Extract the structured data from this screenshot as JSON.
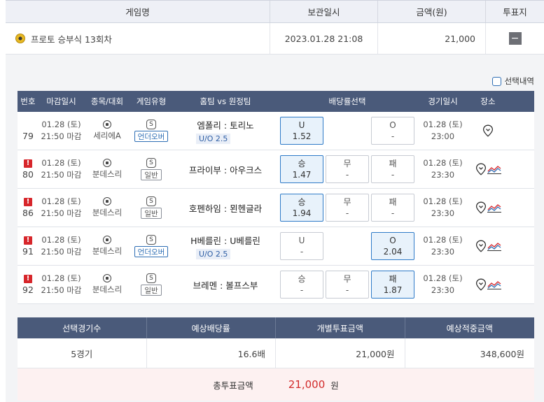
{
  "header": {
    "game_name": "게임명",
    "save_time": "보관일시",
    "amount": "금액(원)",
    "vote_slip": "투표지"
  },
  "slip": {
    "name": "프로토 승부식 13회차",
    "saved_at": "2023.01.28 21:08",
    "amount": "21,000",
    "collapse": "−"
  },
  "select_history": "선택내역",
  "columns": {
    "no": "번호",
    "deadline": "마감일시",
    "sport": "종목/대회",
    "type": "게임유형",
    "teams": "홈팀 vs 원정팀",
    "odds": "배당률선택",
    "match_time": "경기일시",
    "place": "장소"
  },
  "games": [
    {
      "no": "79",
      "alert": false,
      "date": "01.28 (토)",
      "close": "21:50 마감",
      "league": "세리에A",
      "s": "S",
      "type": "언더오버",
      "type_style": "blue",
      "teams": "엠폴리 : 토리노",
      "uo": "U/O 2.5",
      "odds": [
        {
          "label": "U",
          "value": "1.52",
          "sel": true
        },
        {
          "label": "",
          "value": "",
          "sel": false,
          "empty": true
        },
        {
          "label": "O",
          "value": "-",
          "sel": false
        }
      ],
      "m_date": "01.28 (토)",
      "m_time": "23:00",
      "trend": false
    },
    {
      "no": "80",
      "alert": true,
      "date": "01.28 (토)",
      "close": "21:50 마감",
      "league": "분데스리",
      "s": "S",
      "type": "일반",
      "type_style": "gray",
      "teams": "프라이부 : 아우크스",
      "uo": "",
      "odds": [
        {
          "label": "승",
          "value": "1.47",
          "sel": true
        },
        {
          "label": "무",
          "value": "-",
          "sel": false
        },
        {
          "label": "패",
          "value": "-",
          "sel": false
        }
      ],
      "m_date": "01.28 (토)",
      "m_time": "23:30",
      "trend": true
    },
    {
      "no": "86",
      "alert": true,
      "date": "01.28 (토)",
      "close": "21:50 마감",
      "league": "분데스리",
      "s": "S",
      "type": "일반",
      "type_style": "gray",
      "teams": "호펜하임 : 묀헨글라",
      "uo": "",
      "odds": [
        {
          "label": "승",
          "value": "1.94",
          "sel": true
        },
        {
          "label": "무",
          "value": "-",
          "sel": false
        },
        {
          "label": "패",
          "value": "-",
          "sel": false
        }
      ],
      "m_date": "01.28 (토)",
      "m_time": "23:30",
      "trend": true
    },
    {
      "no": "91",
      "alert": true,
      "date": "01.28 (토)",
      "close": "21:50 마감",
      "league": "분데스리",
      "s": "S",
      "type": "언더오버",
      "type_style": "blue",
      "teams": "H베를린 : U베를린",
      "uo": "U/O 2.5",
      "odds": [
        {
          "label": "U",
          "value": "-",
          "sel": false
        },
        {
          "label": "",
          "value": "",
          "sel": false,
          "empty": true
        },
        {
          "label": "O",
          "value": "2.04",
          "sel": true
        }
      ],
      "m_date": "01.28 (토)",
      "m_time": "23:30",
      "trend": true
    },
    {
      "no": "92",
      "alert": true,
      "date": "01.28 (토)",
      "close": "21:50 마감",
      "league": "분데스리",
      "s": "S",
      "type": "일반",
      "type_style": "gray",
      "teams": "브레멘 : 볼프스부",
      "uo": "",
      "odds": [
        {
          "label": "승",
          "value": "-",
          "sel": false
        },
        {
          "label": "무",
          "value": "-",
          "sel": false
        },
        {
          "label": "패",
          "value": "1.87",
          "sel": true
        }
      ],
      "m_date": "01.28 (토)",
      "m_time": "23:30",
      "trend": true
    }
  ],
  "summary": {
    "h_count": "선택경기수",
    "h_odds": "예상배당률",
    "h_bet": "개별투표금액",
    "h_win": "예상적중금액",
    "count": "5경기",
    "odds": "16.6배",
    "bet": "21,000원",
    "win": "348,600원",
    "total_label": "총투표금액",
    "total_value": "21,000",
    "total_unit": "원"
  },
  "icons": {
    "slip": "proto-coin-icon",
    "alert": "alert-icon",
    "sport": "soccer-ball-icon",
    "stadium": "map-pin-icon",
    "trend": "trend-chart-icon"
  },
  "colors": {
    "header_bg": "#4a5a7a",
    "selected_odd": "#e8f2fb",
    "alert_red": "#d7262b",
    "total_red": "#d22b2b"
  }
}
